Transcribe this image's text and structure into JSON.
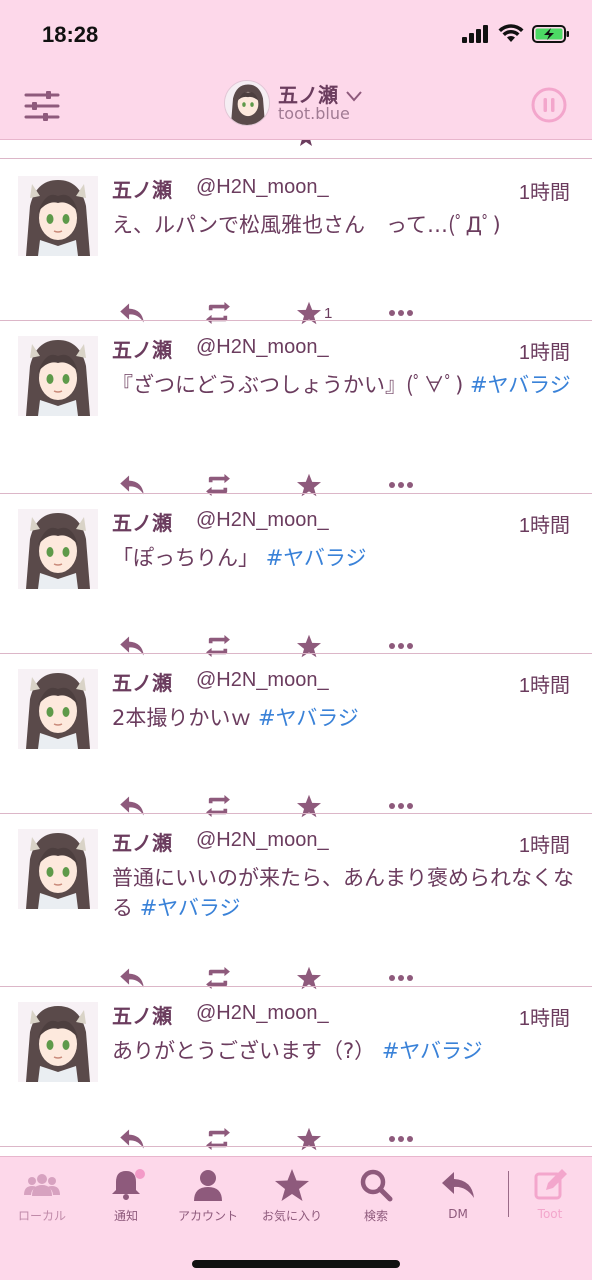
{
  "status_bar": {
    "time": "18:28"
  },
  "header": {
    "display_name": "五ノ瀬",
    "domain": "toot.blue"
  },
  "toots": [
    {
      "display_name": "五ノ瀬",
      "acct": "@H2N_moon_",
      "ago": "1時間",
      "text": "え、ルパンで松風雅也さん　って…(ﾟДﾟ)",
      "tag": "",
      "fav_count": "1"
    },
    {
      "display_name": "五ノ瀬",
      "acct": "@H2N_moon_",
      "ago": "1時間",
      "text": "『ざつにどうぶつしょうかい』(ﾟ∀ﾟ) ",
      "tag": "#ヤバラジ",
      "fav_count": ""
    },
    {
      "display_name": "五ノ瀬",
      "acct": "@H2N_moon_",
      "ago": "1時間",
      "text": "「ぽっちりん」 ",
      "tag": "#ヤバラジ",
      "fav_count": ""
    },
    {
      "display_name": "五ノ瀬",
      "acct": "@H2N_moon_",
      "ago": "1時間",
      "text": "2本撮りかいｗ ",
      "tag": "#ヤバラジ",
      "fav_count": ""
    },
    {
      "display_name": "五ノ瀬",
      "acct": "@H2N_moon_",
      "ago": "1時間",
      "text": "普通にいいのが来たら、あんまり褒められなくなる ",
      "tag": "#ヤバラジ",
      "fav_count": ""
    },
    {
      "display_name": "五ノ瀬",
      "acct": "@H2N_moon_",
      "ago": "1時間",
      "text": "ありがとうございます（?） ",
      "tag": "#ヤバラジ",
      "fav_count": ""
    }
  ],
  "tabs": [
    {
      "label": "ローカル",
      "icon": "people-icon"
    },
    {
      "label": "通知",
      "icon": "bell-icon"
    },
    {
      "label": "アカウント",
      "icon": "person-icon"
    },
    {
      "label": "お気に入り",
      "icon": "star-icon"
    },
    {
      "label": "検索",
      "icon": "search-icon"
    },
    {
      "label": "DM",
      "icon": "reply-icon"
    },
    {
      "label": "Toot",
      "icon": "compose-icon"
    }
  ],
  "colors": {
    "accent": "#6b3c5e",
    "bar_bg": "#fdd8ea",
    "hashtag": "#3a82d8",
    "notification_dot": "#f39ac8"
  }
}
